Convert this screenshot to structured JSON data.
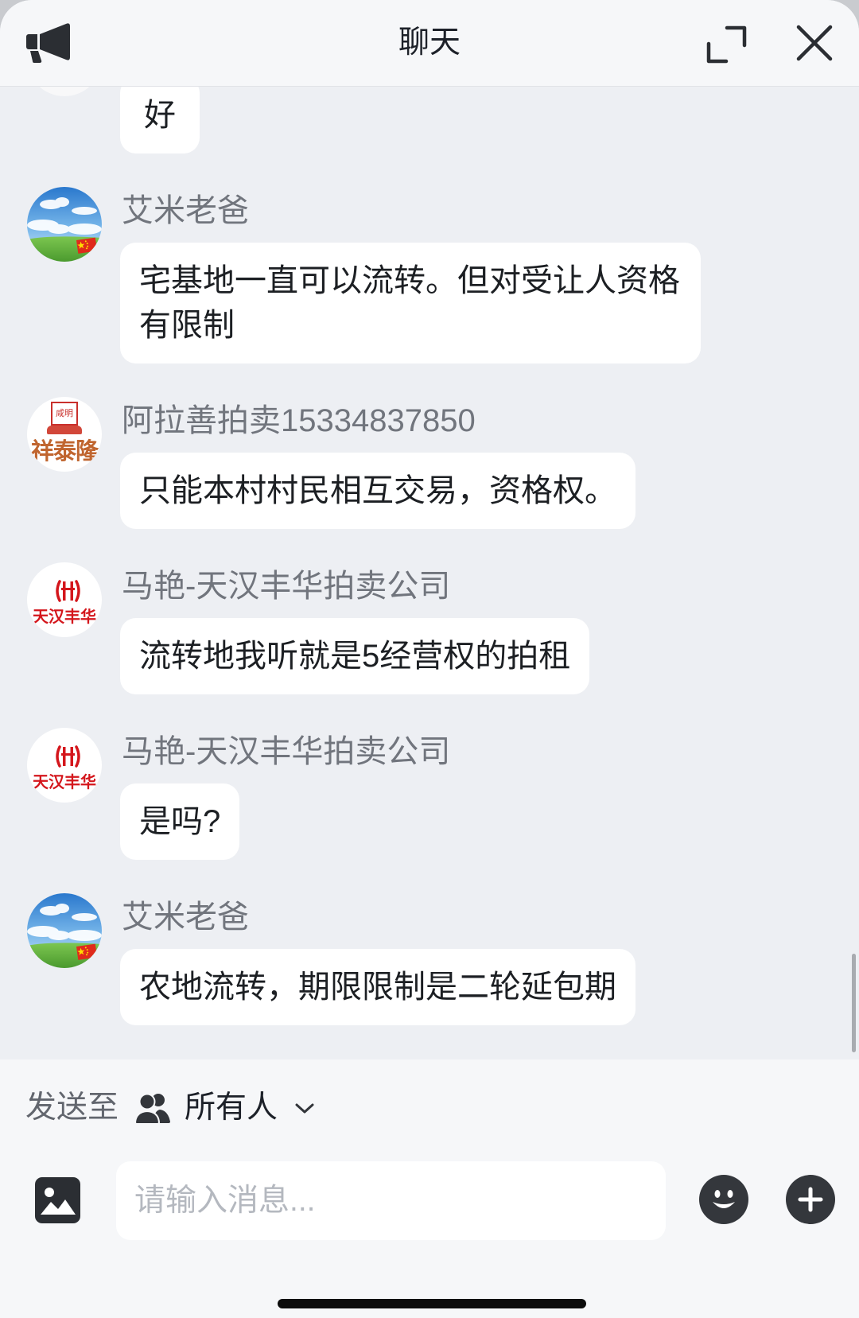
{
  "header": {
    "title": "聊天",
    "left_icon": "megaphone-icon",
    "expand_icon": "expand-icon",
    "close_icon": "close-icon"
  },
  "avatars": {
    "badge_icon": "china-flag-icon",
    "logos": {
      "xiangtailong": {
        "stamp_text": "咸明",
        "text": "祥泰隆"
      },
      "tianhan": {
        "text": "天汉丰华"
      }
    }
  },
  "messages": [
    {
      "avatar_icon": "blank-avatar-icon",
      "text": "好"
    },
    {
      "avatar_icon": "landscape-avatar-icon",
      "sender": "艾米老爸",
      "text": "宅基地一直可以流转。但对受让人资格有限制"
    },
    {
      "avatar_icon": "xiangtailong-logo-icon",
      "sender": "阿拉善拍卖15334837850",
      "text": "只能本村村民相互交易，资格权。"
    },
    {
      "avatar_icon": "tianhan-logo-icon",
      "sender": "马艳-天汉丰华拍卖公司",
      "text": "流转地我听就是5经营权的拍租"
    },
    {
      "avatar_icon": "tianhan-logo-icon",
      "sender": "马艳-天汉丰华拍卖公司",
      "text": "是吗?"
    },
    {
      "avatar_icon": "landscape-avatar-icon",
      "sender": "艾米老爸",
      "text": "农地流转，期限限制是二轮延包期"
    }
  ],
  "composer": {
    "send_to_label": "发送至",
    "recipient": "所有人",
    "recipient_icon": "people-icon",
    "dropdown_icon": "chevron-down-icon",
    "image_icon": "image-icon",
    "input_value": "",
    "placeholder": "请输入消息...",
    "emoji_icon": "emoji-icon",
    "plus_icon": "plus-icon"
  },
  "colors": {
    "header_background": "#f6f7f9",
    "chat_background": "#edeff3",
    "bubble_background": "#ffffff",
    "composer_background": "#f6f7f9",
    "sender_text": "#71757d",
    "icon_dark": "#2b2e33",
    "placeholder_text": "#b4b8bf",
    "logo_red": "#d4161c",
    "logo_brown": "#c0652f"
  }
}
